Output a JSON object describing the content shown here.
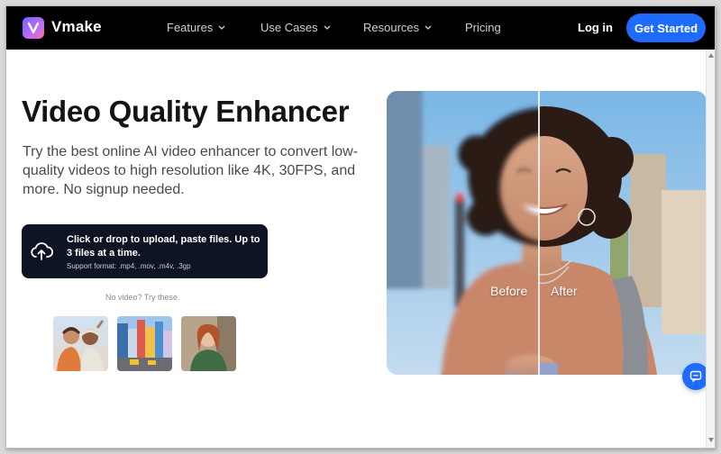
{
  "nav": {
    "logo_text": "Vmake",
    "items": [
      {
        "label": "Features"
      },
      {
        "label": "Use Cases"
      },
      {
        "label": "Resources"
      },
      {
        "label": "Pricing"
      }
    ],
    "login": "Log in",
    "cta": "Get Started"
  },
  "hero": {
    "title": "Video Quality Enhancer",
    "subtitle": "Try the best online AI video enhancer to convert low-quality videos to high resolution like 4K, 30FPS, and more. No signup needed."
  },
  "upload": {
    "main_text": "Click or drop to upload, paste files. Up to 3 files at a time.",
    "formats": "Support format: .mp4, .mov, .m4v, .3gp"
  },
  "samples": {
    "caption": "No video? Try these."
  },
  "compare": {
    "before_label": "Before",
    "after_label": "After"
  },
  "colors": {
    "accent": "#1f6bff",
    "nav_bg": "#000000",
    "upload_bg": "#0f1424"
  }
}
